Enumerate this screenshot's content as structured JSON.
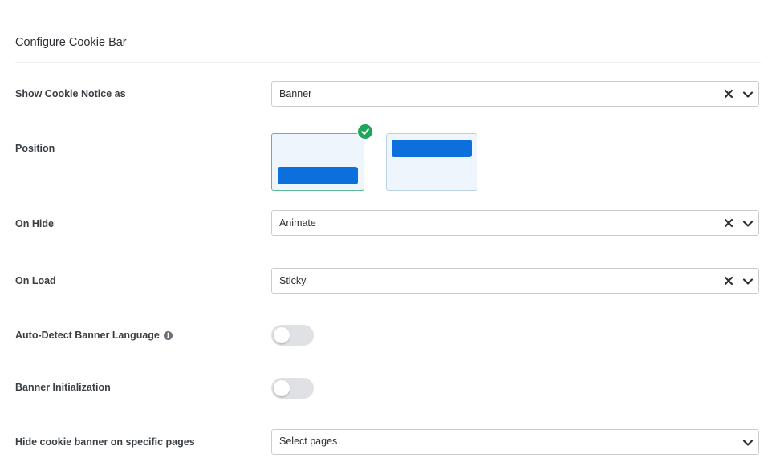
{
  "section": {
    "title": "Configure Cookie Bar"
  },
  "fields": {
    "show_notice": {
      "label": "Show Cookie Notice as",
      "value": "Banner"
    },
    "position": {
      "label": "Position",
      "options": [
        "bottom",
        "top"
      ],
      "selected": "bottom"
    },
    "on_hide": {
      "label": "On Hide",
      "value": "Animate"
    },
    "on_load": {
      "label": "On Load",
      "value": "Sticky"
    },
    "auto_detect": {
      "label": "Auto-Detect Banner Language",
      "info_icon": "i",
      "enabled": false
    },
    "banner_init": {
      "label": "Banner Initialization",
      "enabled": false
    },
    "hide_pages": {
      "label": "Hide cookie banner on specific pages",
      "placeholder": "Select pages"
    }
  },
  "colors": {
    "accent": "#0b6fdc",
    "selected_border": "#5cb897",
    "check_badge": "#1ea65a",
    "toggle_off": "#dfe1e4"
  }
}
